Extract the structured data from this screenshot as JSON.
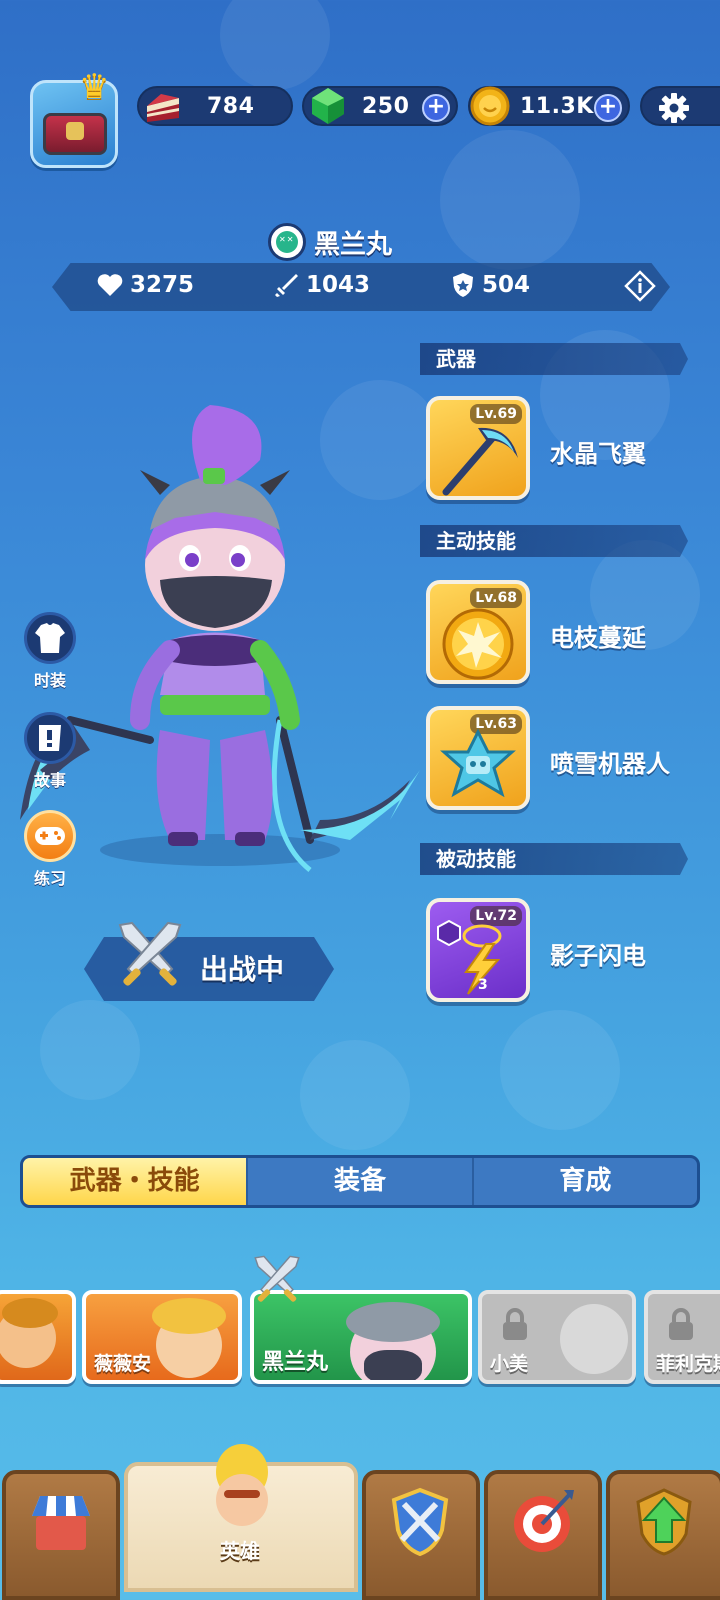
{
  "currency": {
    "cake": "784",
    "gems": "250",
    "coins": "11.3K"
  },
  "hero": {
    "name": "黑兰丸",
    "hp": "3275",
    "attack": "1043",
    "defense": "504",
    "deploy_label": "出战中"
  },
  "sections": {
    "weapon": "武器",
    "active": "主动技能",
    "passive": "被动技能"
  },
  "skills": [
    {
      "level": "Lv.69",
      "name": "水晶飞翼"
    },
    {
      "level": "Lv.68",
      "name": "电枝蔓延"
    },
    {
      "level": "Lv.63",
      "name": "喷雪机器人"
    },
    {
      "level": "Lv.72",
      "name": "影子闪电",
      "stars": "3"
    }
  ],
  "side_buttons": {
    "costume": "时装",
    "story": "故事",
    "practice": "练习"
  },
  "tabs": [
    "武器・技能",
    "装备",
    "育成"
  ],
  "roster": [
    {
      "name": ""
    },
    {
      "name": "薇薇安"
    },
    {
      "name": "黑兰丸"
    },
    {
      "name": "小美"
    },
    {
      "name": "菲利克斯"
    }
  ],
  "nav": {
    "hero_label": "英雄"
  },
  "colors": {
    "bg_top": "#2f6fc7",
    "bg_bottom": "#58bde9",
    "panel": "#1c3a73",
    "tab_active": "#ffd64a",
    "card_gold": "#f0a21c",
    "card_purple": "#6b2fc9",
    "selected_hero": "#2fae5a"
  },
  "icons": {
    "cake": "cake-icon",
    "gem": "gem-icon",
    "coin": "coin-icon",
    "settings": "gear-icon",
    "hp": "heart-icon",
    "attack": "sword-icon",
    "defense": "shield-icon",
    "info": "info-icon"
  }
}
